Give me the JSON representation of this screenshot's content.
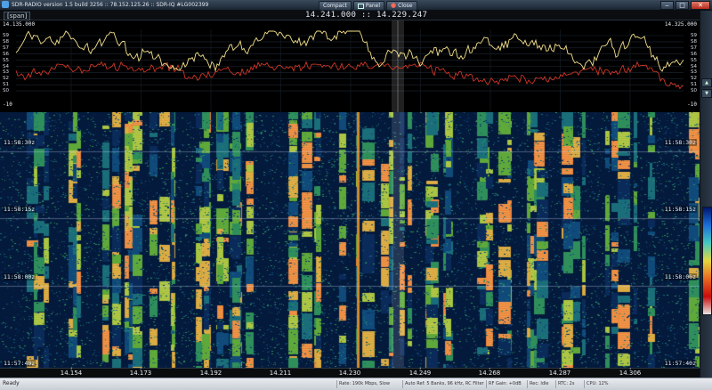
{
  "window": {
    "title": "SDR-RADIO version 1.5 build 3256 :: 78.152.125.26 :: SDR-IQ #LG002399",
    "view_buttons": [
      {
        "label": "Compact"
      },
      {
        "label": "Panel"
      },
      {
        "label": "Close"
      }
    ],
    "controls": {
      "minimize": "‒",
      "maximize": "□",
      "close": "✕"
    }
  },
  "frequency_bar": {
    "span_label": "[span]",
    "center_readout": "14.241.000 :: 14.229.247"
  },
  "spectrum": {
    "left_freq": "14.135.000",
    "right_freq": "14.325.000",
    "smeter_left": [
      "S9",
      "S8",
      "S7",
      "S6",
      "S5",
      "S4",
      "S3",
      "S2",
      "S1",
      "S0"
    ],
    "smeter_right": [
      "S9",
      "S8",
      "S7",
      "S6",
      "S5",
      "S4",
      "S3",
      "S2",
      "S1",
      "S0"
    ],
    "bottom_left": "-10",
    "bottom_right": "-10"
  },
  "waterfall": {
    "time_labels": [
      "11:58:30z",
      "11:58:15z",
      "11:58:00z",
      "11:57:40z"
    ]
  },
  "x_axis": {
    "ticks": [
      "14.154",
      "14.173",
      "14.192",
      "14.211",
      "14.230",
      "14.249",
      "14.268",
      "14.287",
      "14.306"
    ]
  },
  "status_bar": {
    "ready": "Ready",
    "segments": [
      "Rate: 190k Mbps, Slow",
      "Auto Ref: 5 Banks, 96 kHz, RC Filter",
      "RF Gain: +0dB",
      "Rec: Idle",
      "RTC: 2s",
      "CPU: 12%"
    ]
  },
  "colors": {
    "trace_yellow": "#f4e08a",
    "trace_red": "#e23a2a",
    "waterfall_background": "#041a3c",
    "accent": "#4fa0e8"
  }
}
